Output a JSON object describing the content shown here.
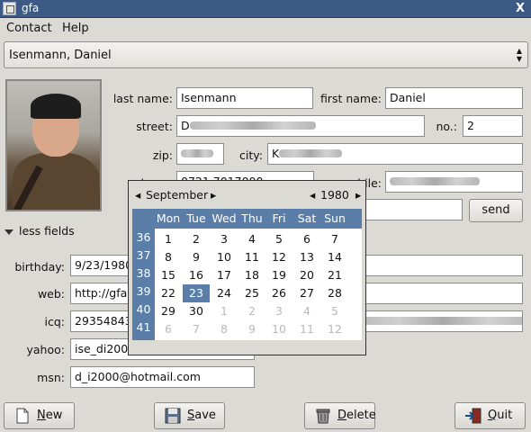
{
  "window": {
    "title": "gfa",
    "close_glyph": "X"
  },
  "menu": [
    {
      "label": "Contact"
    },
    {
      "label": "Help"
    }
  ],
  "contact_select": {
    "value": "Isenmann, Daniel"
  },
  "labels": {
    "last_name": "last name:",
    "first_name": "first name:",
    "street": "street:",
    "no": "no.:",
    "zip": "zip:",
    "city": "city:",
    "phone": "phone:",
    "mobile": "mobile:",
    "birthday": "birthday:",
    "web": "web:",
    "icq": "icq:",
    "yahoo": "yahoo:",
    "msn": "msn:"
  },
  "fields": {
    "last_name": "Isenmann",
    "first_name": "Daniel",
    "street": "D",
    "no": "2",
    "city": "K",
    "phone": "0721 7017000",
    "birthday": "9/23/1980",
    "web": "http://gfa.",
    "icq": "29354843",
    "yahoo": "ise_di200",
    "msn": "d_i2000@hotmail.com"
  },
  "expander": {
    "label": "less fields"
  },
  "send_button": {
    "label": "send"
  },
  "calendar": {
    "month": "September",
    "year": "1980",
    "prev_glyph": "◂",
    "next_glyph": "▸",
    "day_names": [
      "Mon",
      "Tue",
      "Wed",
      "Thu",
      "Fri",
      "Sat",
      "Sun"
    ],
    "weeks": [
      "36",
      "37",
      "38",
      "39",
      "40",
      "41"
    ],
    "days": [
      [
        "1",
        "2",
        "3",
        "4",
        "5",
        "6",
        "7"
      ],
      [
        "8",
        "9",
        "10",
        "11",
        "12",
        "13",
        "14"
      ],
      [
        "15",
        "16",
        "17",
        "18",
        "19",
        "20",
        "21"
      ],
      [
        "22",
        "23",
        "24",
        "25",
        "26",
        "27",
        "28"
      ],
      [
        "29",
        "30",
        "1",
        "2",
        "3",
        "4",
        "5"
      ],
      [
        "6",
        "7",
        "8",
        "9",
        "10",
        "11",
        "12"
      ]
    ],
    "selected_day": "23"
  },
  "buttons": {
    "new": {
      "mnemonic": "N",
      "rest": "ew"
    },
    "save": {
      "mnemonic": "S",
      "rest": "ave"
    },
    "delete": {
      "mnemonic": "D",
      "rest": "elete"
    },
    "quit": {
      "mnemonic": "Q",
      "rest": "uit"
    }
  },
  "icons": {
    "new": "new-document-icon",
    "save": "floppy-disk-icon",
    "delete": "trash-can-icon",
    "quit": "exit-door-icon"
  }
}
